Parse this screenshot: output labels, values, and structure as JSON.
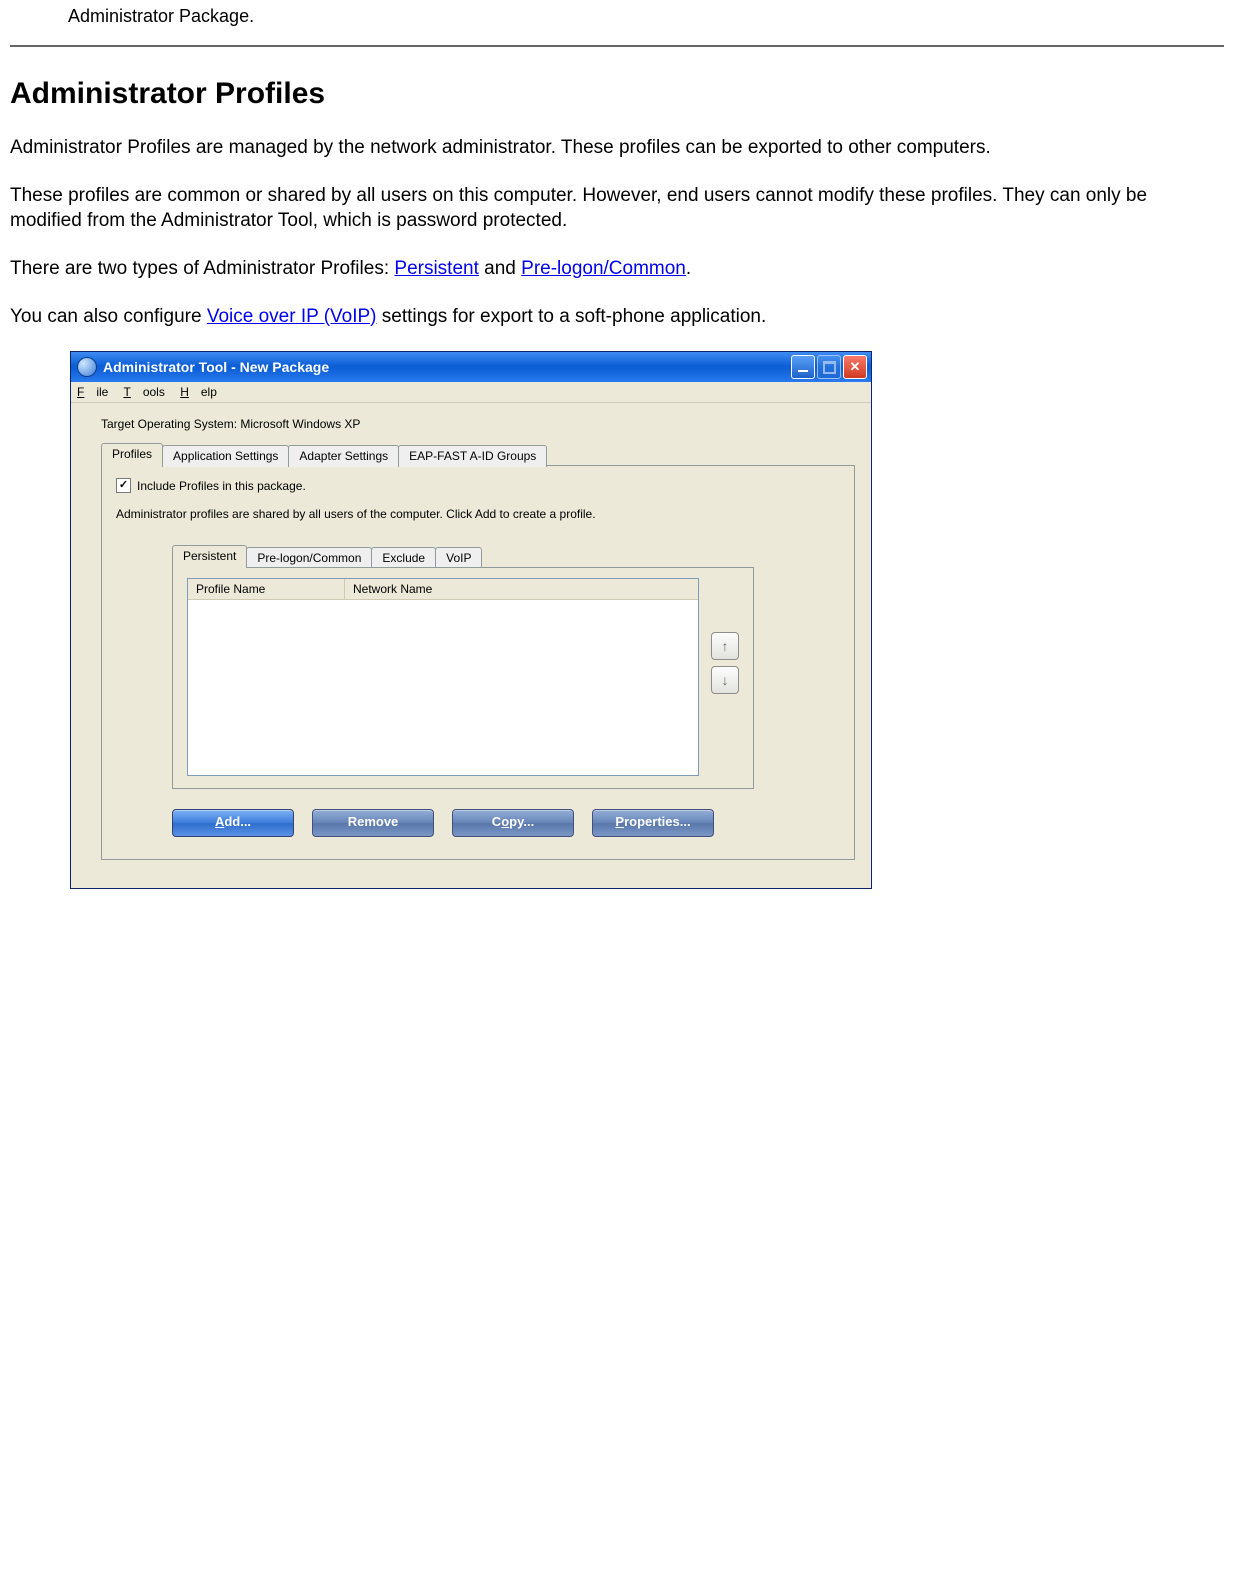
{
  "doc": {
    "crumb": "Administrator Package.",
    "heading": "Administrator Profiles",
    "para1": "Administrator Profiles are managed by the network administrator. These profiles can be exported to other computers.",
    "para2": "These profiles are common or shared by all users on this computer. However, end users cannot modify these profiles. They can only be modified from the Administrator Tool, which is password protected.",
    "para3_pre": "There are two types of Administrator Profiles: ",
    "link_persistent": "Persistent",
    "para3_mid": " and ",
    "link_prelogon": "Pre-logon/Common",
    "para3_post": ".",
    "para4_pre": "You can also configure ",
    "link_voip": "Voice over IP (VoIP)",
    "para4_post": " settings for export to a soft-phone application."
  },
  "window": {
    "title": "Administrator Tool - New Package",
    "menu": {
      "file": "File",
      "tools": "Tools",
      "help": "Help"
    },
    "target_os_label": "Target Operating System: Microsoft Windows XP",
    "outer_tabs": [
      "Profiles",
      "Application Settings",
      "Adapter Settings",
      "EAP-FAST A-ID Groups"
    ],
    "checkbox_label": "Include Profiles in this package.",
    "checkbox_checked": "✓",
    "helptext": "Administrator profiles are shared by all users of the computer. Click Add to create a profile.",
    "inner_tabs": [
      "Persistent",
      "Pre-logon/Common",
      "Exclude",
      "VoIP"
    ],
    "list_columns": {
      "c1": "Profile Name",
      "c2": "Network Name"
    },
    "arrow_up": "↑",
    "arrow_down": "↓",
    "buttons": {
      "add": "Add...",
      "remove": "Remove",
      "copy": "Copy...",
      "properties": "Properties..."
    }
  }
}
